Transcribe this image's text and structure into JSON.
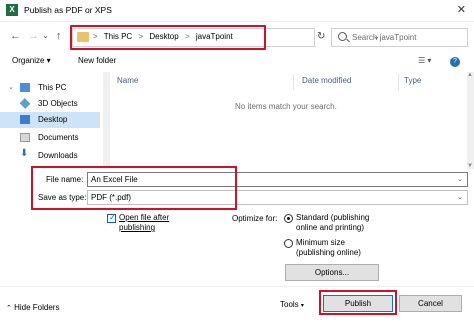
{
  "window": {
    "title": "Publish as PDF or XPS",
    "app_icon": "X"
  },
  "nav": {
    "breadcrumbs": [
      "This PC",
      "Desktop",
      "javaTpoint"
    ],
    "separator": ">",
    "search_placeholder": "Search javaTpoint"
  },
  "toolbar": {
    "organize": "Organize ▾",
    "new_folder": "New folder"
  },
  "sidebar": {
    "items": [
      {
        "label": "This PC",
        "icon": "pc-icon"
      },
      {
        "label": "3D Objects",
        "icon": "cube-icon"
      },
      {
        "label": "Desktop",
        "icon": "desktop-icon",
        "selected": true
      },
      {
        "label": "Documents",
        "icon": "documents-icon"
      },
      {
        "label": "Downloads",
        "icon": "downloads-icon"
      }
    ]
  },
  "filelist": {
    "columns": [
      "Name",
      "Date modified",
      "Type"
    ],
    "empty_message": "No items match your search."
  },
  "form": {
    "file_name_label": "File name:",
    "file_name_value": "An Excel File",
    "save_type_label": "Save as type:",
    "save_type_value": "PDF (*.pdf)"
  },
  "options": {
    "open_after_label": "Open file after publishing",
    "open_after_checked": true,
    "optimize_label": "Optimize for:",
    "standard_label": "Standard (publishing online and printing)",
    "minimum_label": "Minimum size (publishing online)",
    "selected": "standard",
    "options_button": "Options..."
  },
  "footer": {
    "hide_folders": "Hide Folders",
    "tools": "Tools",
    "publish": "Publish",
    "cancel": "Cancel"
  },
  "colors": {
    "highlight": "#d0102c",
    "selection": "#cce4f7",
    "accent": "#0078d7"
  }
}
